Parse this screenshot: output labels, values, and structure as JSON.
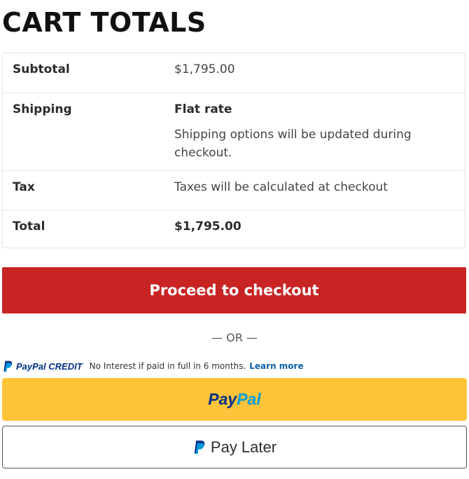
{
  "title": "CART TOTALS",
  "totals": {
    "subtotal": {
      "label": "Subtotal",
      "value": "$1,795.00"
    },
    "shipping": {
      "label": "Shipping",
      "method": "Flat rate",
      "note_line1": "Shipping options will be updated during",
      "note_line2": "checkout."
    },
    "tax": {
      "label": "Tax",
      "value": "Taxes will be calculated at checkout"
    },
    "total": {
      "label": "Total",
      "value": "$1,795.00"
    }
  },
  "checkout_button": "Proceed to checkout",
  "or_separator": "— OR —",
  "paypal_credit": {
    "brand_pay": "PayPal",
    "brand_credit": "CREDIT",
    "text": "No Interest if paid in full in 6 months.",
    "link": "Learn more"
  },
  "paypal_button": {
    "pay": "Pay",
    "pal": "Pal"
  },
  "pay_later_button": "Pay Later",
  "colors": {
    "checkout_red": "#c92424",
    "paypal_yellow": "#fdc43a",
    "paypal_navy": "#003087",
    "paypal_blue": "#009cde"
  }
}
